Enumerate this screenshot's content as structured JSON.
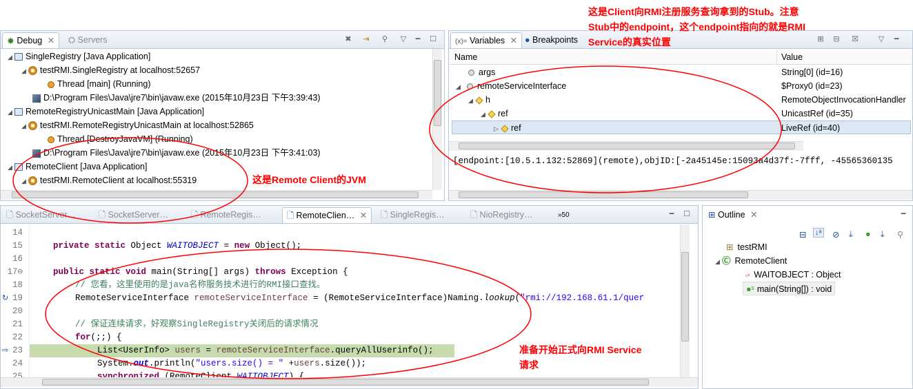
{
  "debug": {
    "tabs": [
      "Debug",
      "Servers"
    ],
    "items": [
      "SingleRegistry [Java Application]",
      "testRMI.SingleRegistry at localhost:52657",
      "Thread [main] (Running)",
      "D:\\Program Files\\Java\\jre7\\bin\\javaw.exe (2015年10月23日 下午3:39:43)",
      "RemoteRegistryUnicastMain [Java Application]",
      "testRMI.RemoteRegistryUnicastMain at localhost:52865",
      "Thread [DestroyJavaVM] (Running)",
      "D:\\Program Files\\Java\\jre7\\bin\\javaw.exe (2015年10月23日 下午3:41:03)",
      "RemoteClient [Java Application]",
      "testRMI.RemoteClient at localhost:55319"
    ]
  },
  "variables": {
    "tabs": [
      "Variables",
      "Breakpoints"
    ],
    "col_name": "Name",
    "col_value": "Value",
    "rows": [
      {
        "name": "args",
        "value": "String[0]  (id=16)"
      },
      {
        "name": "remoteServiceInterface",
        "value": "$Proxy0  (id=23)"
      },
      {
        "name": "h",
        "value": "RemoteObjectInvocationHandler"
      },
      {
        "name": "ref",
        "value": "UnicastRef  (id=35)"
      },
      {
        "name": "ref",
        "value": "LiveRef  (id=40)"
      }
    ],
    "detail": "[endpoint:[10.5.1.132:52869](remote),objID:[-2a45145e:15093a4d37f:-7fff, -45565360135"
  },
  "editor": {
    "tabs": [
      "SocketServer…",
      "SocketServer…",
      "RemoteRegis…",
      "RemoteClien…",
      "SingleRegis…",
      "NioRegistry…"
    ],
    "overflow": "»50",
    "line_numbers": [
      "14",
      "15",
      "16",
      "17⊖",
      "18",
      "19",
      "20",
      "21",
      "22",
      "23",
      "24",
      "25"
    ]
  },
  "outline": {
    "title": "Outline",
    "items": [
      "testRMI",
      "RemoteClient",
      "WAITOBJECT : Object",
      "main(String[]) : void"
    ]
  },
  "annotations": {
    "stub": "这是Client向RMI注册服务查询拿到的Stub。注意\nStub中的endpoint，这个endpoint指向的就是RMI\nService的真实位置",
    "jvm": "这是Remote Client的JVM",
    "request": "准备开始正式向RMI Service\n请求"
  },
  "colors": {
    "annotation": "#ff0000",
    "keyword": "#7f0055",
    "comment": "#3f7f5f",
    "highlight": "#c6dbae"
  }
}
